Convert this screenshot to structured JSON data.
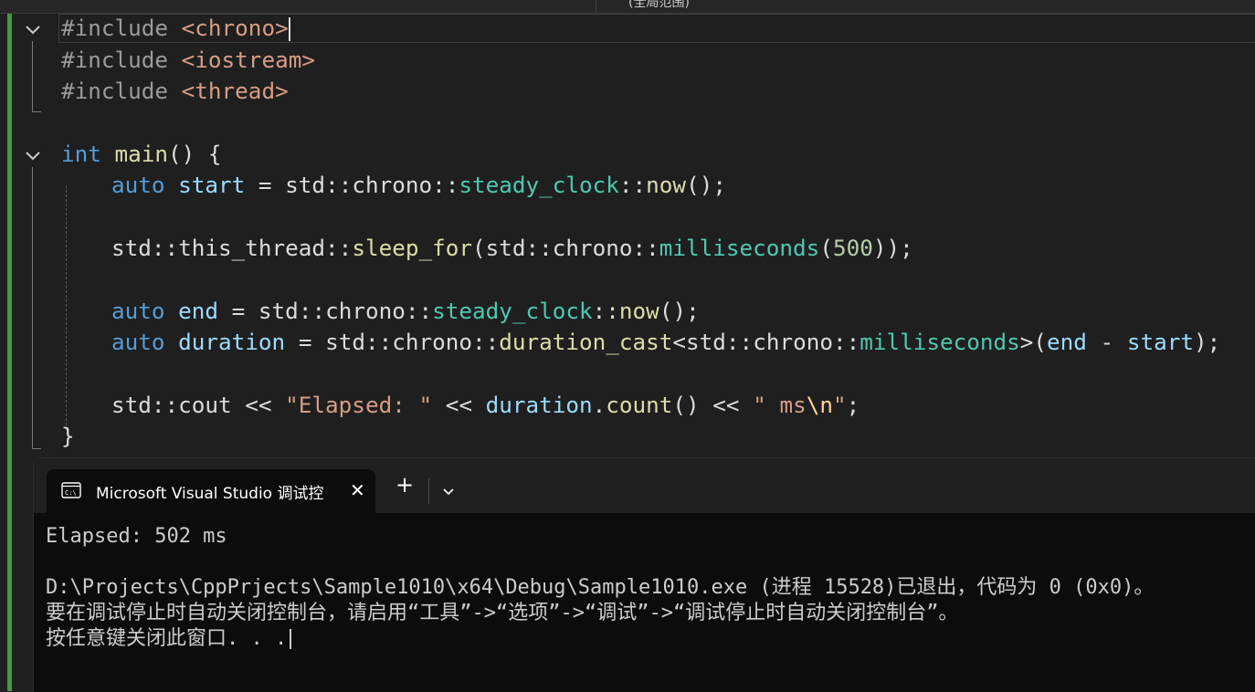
{
  "top_bar": {
    "scope_label": "(全局范围)"
  },
  "editor": {
    "lines": [
      {
        "pp": "#include",
        "rest": " ",
        "inc": "<chrono>"
      },
      {
        "pp": "#include",
        "rest": " ",
        "inc": "<iostream>"
      },
      {
        "pp": "#include",
        "rest": " ",
        "inc": "<thread>"
      },
      {
        "kw": "int",
        "fn": "main",
        "rest": "() {"
      },
      {
        "text": "auto start = std::chrono::steady_clock::now();"
      },
      {
        "text": "std::this_thread::sleep_for(std::chrono::milliseconds(500));"
      },
      {
        "text": "auto end = std::chrono::steady_clock::now();"
      },
      {
        "text": "auto duration = std::chrono::duration_cast<std::chrono::milliseconds>(end - start);"
      },
      {
        "text": "std::cout << \"Elapsed: \" << duration.count() << \" ms\\n\";"
      },
      {
        "text": "}"
      }
    ]
  },
  "console": {
    "tab_title": "Microsoft Visual Studio 调试控",
    "tab_close": "✕",
    "new_tab": "+",
    "output": [
      "Elapsed: 502 ms",
      "",
      "D:\\Projects\\CppPrjects\\Sample1010\\x64\\Debug\\Sample1010.exe (进程 15528)已退出，代码为 0 (0x0)。",
      "要在调试停止时自动关闭控制台，请启用“工具”->“选项”->“调试”->“调试停止时自动关闭控制台”。",
      "按任意键关闭此窗口. . ."
    ]
  },
  "icons": [
    "fold-chevron-icon",
    "terminal-icon",
    "close-icon",
    "plus-icon",
    "chevron-down-icon"
  ]
}
